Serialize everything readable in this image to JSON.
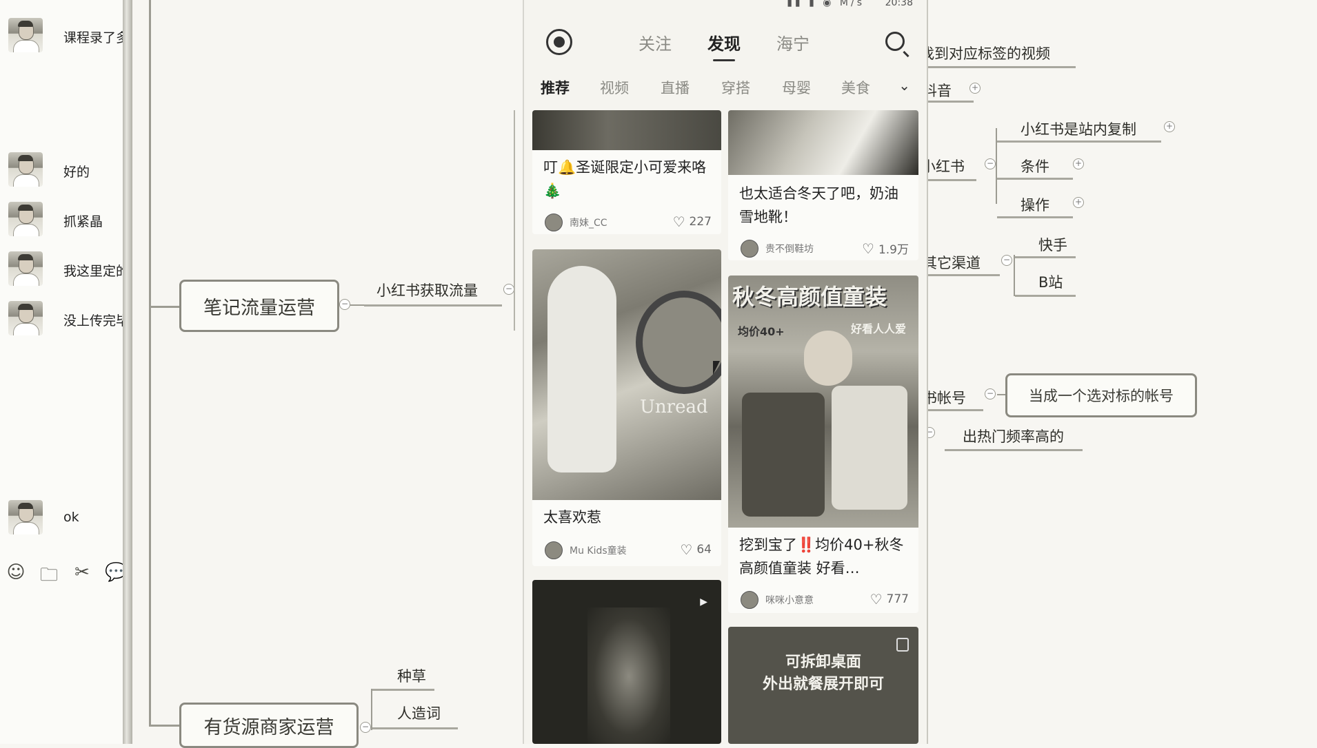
{
  "chat": {
    "messages": [
      {
        "text": "课程录了多"
      },
      {
        "text": "好的"
      },
      {
        "text": "抓紧晶"
      },
      {
        "text": "我这里定的"
      },
      {
        "text": "没上传完毕"
      },
      {
        "text": "ok"
      }
    ],
    "tools": [
      "emoji-icon",
      "folder-icon",
      "scissors-icon",
      "chat-bubble-icon"
    ]
  },
  "mindmap": {
    "main_node_1": "笔记流量运营",
    "main_node_2": "有货源商家运营",
    "branch_xhs_traffic": "小红书获取流量",
    "zhongcao": "种草",
    "renzaoci": "人造词",
    "find_tagged_videos": "找到对应标签的视频",
    "douyin": "抖音",
    "xiaohongshu": "小红书",
    "xhs_copy": "小红书是站内复制",
    "condition": "条件",
    "operation": "操作",
    "other_channels": "其它渠道",
    "kuaishou": "快手",
    "bilibili": "B站",
    "xhs_account": "书帐号",
    "as_benchmark": "当成一个选对标的帐号",
    "hot_frequency": "出热门频率高的"
  },
  "phone": {
    "status_time": "20:38",
    "status_indicators": "▮▮ ▮ ◉ M/s",
    "topnav": {
      "follow": "关注",
      "discover": "发现",
      "location": "海宁"
    },
    "categories": [
      "推荐",
      "视频",
      "直播",
      "穿搭",
      "母婴",
      "美食"
    ],
    "cards": [
      {
        "title": "叮🔔圣诞限定小可爱来咯🎄",
        "author": "南妹_CC",
        "likes": "227"
      },
      {
        "title": "也太适合冬天了吧，奶油雪地靴！",
        "author": "贵不倒鞋坊",
        "likes": "1.9万"
      },
      {
        "title": "太喜欢惹",
        "author": "Mu Kids童装",
        "likes": "64",
        "image_text": "Unread"
      },
      {
        "title": "挖到宝了‼️均价40+秋冬高颜值童装 好看…",
        "author": "咪咪小意意",
        "likes": "777",
        "overlay": "秋冬高颜值童装",
        "overlay_sub": "均价40+",
        "overlay_right": "好看人人爱"
      },
      {
        "overlay": "可拆卸桌面\n外出就餐展开即可"
      }
    ]
  }
}
